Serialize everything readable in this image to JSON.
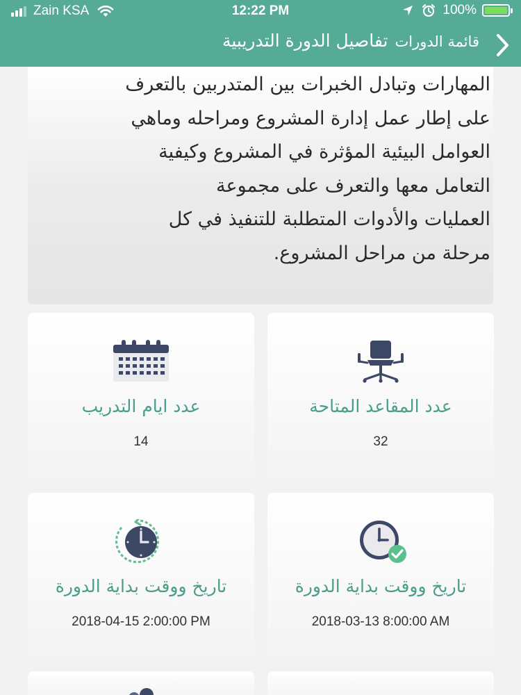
{
  "status_bar": {
    "carrier": "Zain KSA",
    "time": "12:22 PM",
    "battery": "100%",
    "battery_level": 1.0
  },
  "nav": {
    "back_label": "قائمة الدورات",
    "title": "تفاصيل الدورة التدريبية"
  },
  "description": {
    "lines": [
      "المهارات وتبادل الخبرات بين المتدربين بالتعرف",
      "على إطار عمل إدارة المشروع ومراحله وماهي",
      "العوامل البيئية المؤثرة في المشروع وكيفية",
      "التعامل معها والتعرف على مجموعة",
      "العمليات والأدوات المتطلبة للتنفيذ في كل",
      "مرحلة من مراحل المشروع."
    ]
  },
  "cards": [
    {
      "label": "عدد المقاعد المتاحة",
      "value": "32",
      "icon": "chair-icon"
    },
    {
      "label": "عدد ايام التدريب",
      "value": "14",
      "icon": "calendar-icon"
    },
    {
      "label": "تاريخ ووقت بداية الدورة",
      "value": "2018-03-13  8:00:00 AM",
      "icon": "clock-check-icon"
    },
    {
      "label": "تاريخ ووقت بداية الدورة",
      "value": "2018-04-15 2:00:00 PM",
      "icon": "clock-history-icon"
    }
  ],
  "colors": {
    "primary": "#55ab96",
    "label": "#4a9d8b",
    "icon_dark": "#3d4766",
    "check": "#5bbf8e"
  }
}
